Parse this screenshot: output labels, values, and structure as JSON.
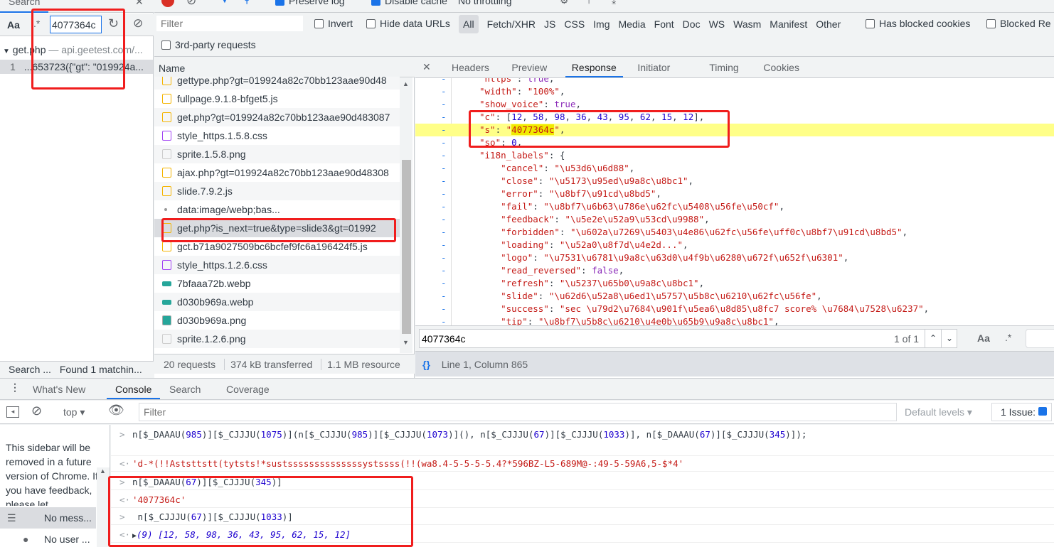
{
  "search_panel": {
    "title": "Search",
    "case_label": "Aa",
    "regex_label": ".*",
    "query": "4077364c",
    "result_file": "get.php",
    "result_host": "— api.geetest.com/...",
    "result_line_no": "1",
    "result_snippet": "...653723({\"gt\": \"019924a...",
    "status_left": "Search ...",
    "status_right": "Found 1 matchin..."
  },
  "network_toolbar": {
    "preserve_log": "Preserve log",
    "disable_cache": "Disable cache",
    "throttling": "No throttling"
  },
  "filter_bar": {
    "placeholder": "Filter",
    "invert": "Invert",
    "hide_data_urls": "Hide data URLs",
    "types": [
      "All",
      "Fetch/XHR",
      "JS",
      "CSS",
      "Img",
      "Media",
      "Font",
      "Doc",
      "WS",
      "Wasm",
      "Manifest",
      "Other"
    ],
    "has_blocked_cookies": "Has blocked cookies",
    "blocked_requests": "Blocked Re",
    "third_party": "3rd-party requests"
  },
  "requests": {
    "header": "Name",
    "rows": [
      {
        "name": "gettype.php?gt=019924a82c70bb123aae90d48",
        "type": "script"
      },
      {
        "name": "fullpage.9.1.8-bfget5.js",
        "type": "script"
      },
      {
        "name": "get.php?gt=019924a82c70bb123aae90d483087",
        "type": "script"
      },
      {
        "name": "style_https.1.5.8.css",
        "type": "css"
      },
      {
        "name": "sprite.1.5.8.png",
        "type": "img"
      },
      {
        "name": "ajax.php?gt=019924a82c70bb123aae90d48308",
        "type": "script"
      },
      {
        "name": "slide.7.9.2.js",
        "type": "script"
      },
      {
        "name": "data:image/webp;bas...",
        "type": "data"
      },
      {
        "name": "get.php?is_next=true&type=slide3&gt=01992",
        "type": "script"
      },
      {
        "name": "gct.b71a9027509bc6bcfef9fc6a196424f5.js",
        "type": "script"
      },
      {
        "name": "style_https.1.2.6.css",
        "type": "css"
      },
      {
        "name": "7bfaaa72b.webp",
        "type": "webp"
      },
      {
        "name": "d030b969a.webp",
        "type": "webp"
      },
      {
        "name": "d030b969a.png",
        "type": "png"
      },
      {
        "name": "sprite.1.2.6.png",
        "type": "img"
      }
    ],
    "selected_index": 8,
    "summary": {
      "requests": "20 requests",
      "transferred": "374 kB transferred",
      "resources": "1.1 MB resource"
    }
  },
  "detail": {
    "tabs": [
      "Headers",
      "Preview",
      "Response",
      "Initiator",
      "Timing",
      "Cookies"
    ],
    "active_tab": "Response",
    "code": [
      {
        "i": 1,
        "k": "https",
        "v": "true",
        "t": "b"
      },
      {
        "i": 1,
        "k": "width",
        "v": "\"100%\"",
        "t": "s"
      },
      {
        "i": 1,
        "k": "show_voice",
        "v": "true",
        "t": "b"
      },
      {
        "i": 1,
        "k": "c",
        "v": [
          12,
          58,
          98,
          36,
          43,
          95,
          62,
          15,
          12
        ],
        "t": "arr"
      },
      {
        "i": 1,
        "k": "s",
        "v": "4077364c",
        "t": "match"
      },
      {
        "i": 1,
        "k": "so",
        "v": "0",
        "t": "n"
      },
      {
        "i": 1,
        "k": "i18n_labels",
        "v": "{",
        "t": "open"
      },
      {
        "i": 2,
        "k": "cancel",
        "v": "\"\\u53d6\\u6d88\"",
        "t": "s"
      },
      {
        "i": 2,
        "k": "close",
        "v": "\"\\u5173\\u95ed\\u9a8c\\u8bc1\"",
        "t": "s"
      },
      {
        "i": 2,
        "k": "error",
        "v": "\"\\u8bf7\\u91cd\\u8bd5\"",
        "t": "s"
      },
      {
        "i": 2,
        "k": "fail",
        "v": "\"\\u8bf7\\u6b63\\u786e\\u62fc\\u5408\\u56fe\\u50cf\"",
        "t": "s"
      },
      {
        "i": 2,
        "k": "feedback",
        "v": "\"\\u5e2e\\u52a9\\u53cd\\u9988\"",
        "t": "s"
      },
      {
        "i": 2,
        "k": "forbidden",
        "v": "\"\\u602a\\u7269\\u5403\\u4e86\\u62fc\\u56fe\\uff0c\\u8bf7\\u91cd\\u8bd5\"",
        "t": "s"
      },
      {
        "i": 2,
        "k": "loading",
        "v": "\"\\u52a0\\u8f7d\\u4e2d...\"",
        "t": "s"
      },
      {
        "i": 2,
        "k": "logo",
        "v": "\"\\u7531\\u6781\\u9a8c\\u63d0\\u4f9b\\u6280\\u672f\\u652f\\u6301\"",
        "t": "s"
      },
      {
        "i": 2,
        "k": "read_reversed",
        "v": "false",
        "t": "b"
      },
      {
        "i": 2,
        "k": "refresh",
        "v": "\"\\u5237\\u65b0\\u9a8c\\u8bc1\"",
        "t": "s"
      },
      {
        "i": 2,
        "k": "slide",
        "v": "\"\\u62d6\\u52a8\\u6ed1\\u5757\\u5b8c\\u6210\\u62fc\\u56fe\"",
        "t": "s"
      },
      {
        "i": 2,
        "k": "success",
        "v": "\"sec \\u79d2\\u7684\\u901f\\u5ea6\\u8d85\\u8fc7 score% \\u7684\\u7528\\u6237\"",
        "t": "s"
      },
      {
        "i": 2,
        "k": "tip",
        "v": "\"\\u8bf7\\u5b8c\\u6210\\u4e0b\\u65b9\\u9a8c\\u8bc1\"",
        "t": "s"
      }
    ],
    "find_query": "4077364c",
    "find_count": "1 of 1",
    "find_case": "Aa",
    "find_regex": ".*",
    "cursor": "Line 1, Column 865",
    "pretty_icon": "{}"
  },
  "drawer": {
    "tabs": [
      "What's New",
      "Console",
      "Search",
      "Coverage"
    ],
    "active_tab": "Console"
  },
  "console": {
    "context": "top",
    "filter_placeholder": "Filter",
    "levels": "Default levels",
    "issues": "1 Issue:",
    "sidebar_notice": "This sidebar will be removed in a future version of Chrome. If you have feedback, please let",
    "sidebar_items": [
      "No mess...",
      "No user ..."
    ],
    "messages": [
      {
        "dir": "in",
        "text": "n[$_DAAAU(985)][$_CJJJU(1075)](n[$_CJJJU(985)][$_CJJJU(1073)](), n[$_CJJJU(67)][$_CJJJU(1033)], n[$_DAAAU(67)][$_CJJJU(345)]);"
      },
      {
        "dir": "out",
        "text": "'d-*(!!Aststtstt(tytsts!*sustssssssssssssssystssss(!!(wa8.4-5-5-5-5.4?*596BZ-L5-689M@-:49-5-59A6,5-$*4'",
        "t": "str"
      },
      {
        "dir": "in",
        "text": "n[$_DAAAU(67)][$_CJJJU(345)]"
      },
      {
        "dir": "out",
        "text": "'4077364c'",
        "t": "str"
      },
      {
        "dir": "in",
        "text": " n[$_CJJJU(67)][$_CJJJU(1033)]"
      },
      {
        "dir": "out",
        "text": "(9) [12, 58, 98, 36, 43, 95, 62, 15, 12]",
        "t": "arr"
      }
    ]
  }
}
